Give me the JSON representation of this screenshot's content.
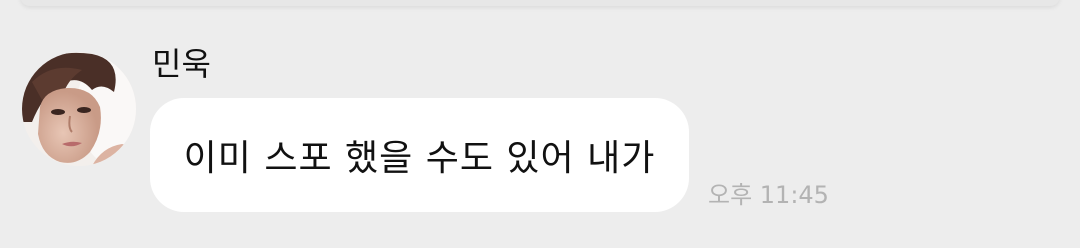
{
  "chat": {
    "message": {
      "sender_name": "민욱",
      "avatar": "profile-photo",
      "text": "이미 스포 했을 수도 있어 내가",
      "time": "오후 11:45"
    }
  },
  "colors": {
    "background": "#ededed",
    "bubble": "#ffffff",
    "text": "#111111",
    "timestamp": "#b3b3b3"
  }
}
